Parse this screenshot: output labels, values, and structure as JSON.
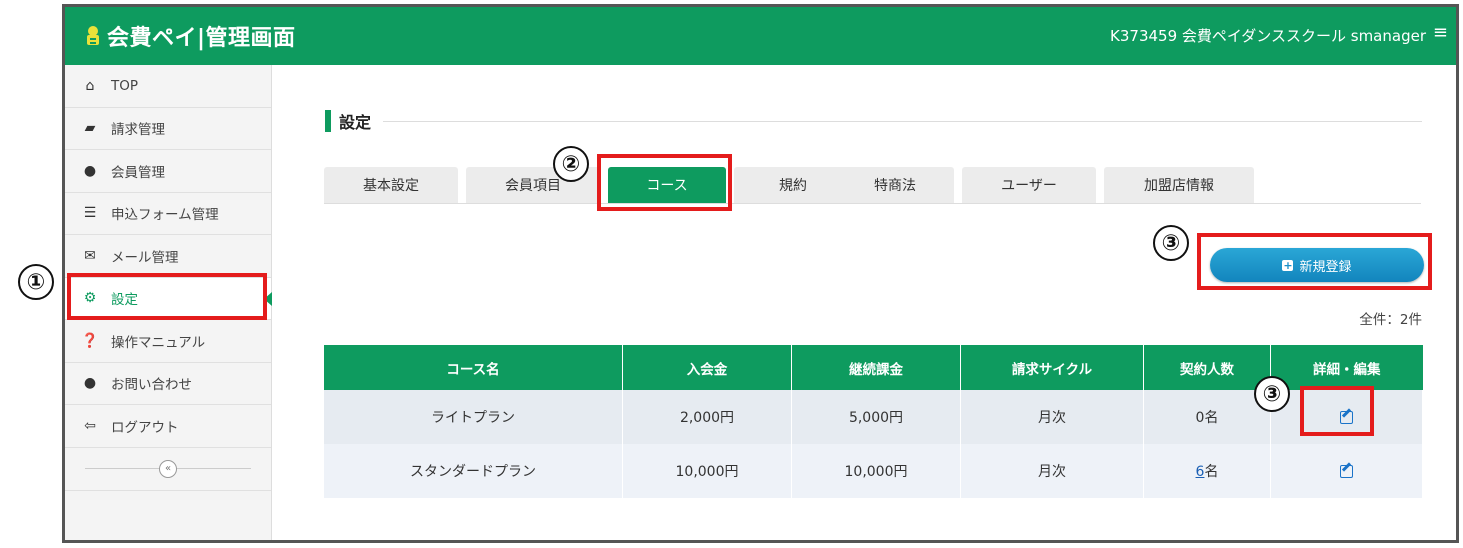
{
  "header": {
    "title": "会費ペイ|管理画面",
    "user_info": "K373459 会費ペイダンススクール smanager",
    "menu_icon": "≡"
  },
  "sidebar": {
    "items": [
      {
        "label": "TOP",
        "icon": "home-icon"
      },
      {
        "label": "請求管理",
        "icon": "book-icon"
      },
      {
        "label": "会員管理",
        "icon": "user-icon"
      },
      {
        "label": "申込フォーム管理",
        "icon": "list-icon"
      },
      {
        "label": "メール管理",
        "icon": "envelope-icon"
      },
      {
        "label": "設定",
        "icon": "gears-icon"
      },
      {
        "label": "操作マニュアル",
        "icon": "question-icon"
      },
      {
        "label": "お問い合わせ",
        "icon": "chat-icon"
      },
      {
        "label": "ログアウト",
        "icon": "logout-icon"
      }
    ],
    "collapse_label": "«"
  },
  "main": {
    "section_title": "設定",
    "tabs": [
      {
        "label": "基本設定"
      },
      {
        "label": "会員項目"
      },
      {
        "label": "コース"
      },
      {
        "label": "規約"
      },
      {
        "label": "特商法"
      },
      {
        "label": "ユーザー"
      },
      {
        "label": "加盟店情報"
      }
    ],
    "new_button": "新規登録",
    "total": "全件：2件",
    "table": {
      "headers": [
        "コース名",
        "入会金",
        "継続課金",
        "請求サイクル",
        "契約人数",
        "詳細・編集"
      ],
      "rows": [
        {
          "name": "ライトプラン",
          "join_fee": "2,000円",
          "recurring": "5,000円",
          "cycle": "月次",
          "count_prefix": "",
          "count_link": "",
          "count_suffix": "0名"
        },
        {
          "name": "スタンダードプラン",
          "join_fee": "10,000円",
          "recurring": "10,000円",
          "cycle": "月次",
          "count_prefix": "",
          "count_link": "6",
          "count_suffix": "名"
        }
      ]
    }
  },
  "annotations": {
    "step1": "①",
    "step2": "②",
    "step3a": "③",
    "step3b": "③",
    "mark_color": "#e41c1c"
  },
  "colors": {
    "brand_green": "#0e9b5f",
    "button_blue": "#1a8fc8"
  }
}
